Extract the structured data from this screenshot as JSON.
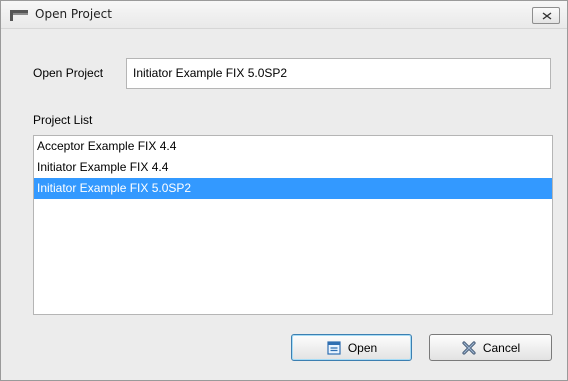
{
  "window": {
    "title": "Open Project"
  },
  "form": {
    "open_label": "Open Project",
    "open_value": "Initiator Example FIX 5.0SP2",
    "list_label": "Project List"
  },
  "projects": [
    {
      "label": "Acceptor Example FIX 4.4",
      "selected": false
    },
    {
      "label": "Initiator Example FIX 4.4",
      "selected": false
    },
    {
      "label": "Initiator Example FIX 5.0SP2",
      "selected": true
    }
  ],
  "buttons": {
    "open_label": "Open",
    "cancel_label": "Cancel"
  },
  "icons": {
    "app": "window-icon",
    "close": "close-icon",
    "open": "open-folder-icon",
    "cancel": "cancel-icon"
  },
  "colors": {
    "selection": "#3399ff",
    "dialog_bg": "#ececec"
  }
}
